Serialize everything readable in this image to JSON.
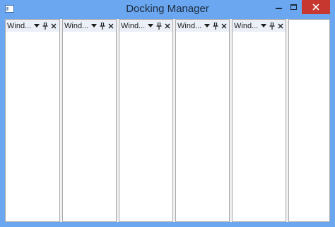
{
  "window": {
    "title": "Docking Manager",
    "frame_color": "#6aa7f0",
    "close_color": "#c7372f"
  },
  "panes": [
    {
      "title": "Wind...",
      "buttons": [
        "dropdown-icon",
        "pin-icon",
        "close-icon"
      ]
    },
    {
      "title": "Wind...",
      "buttons": [
        "dropdown-icon",
        "pin-icon",
        "close-icon"
      ]
    },
    {
      "title": "Wind...",
      "buttons": [
        "dropdown-icon",
        "pin-icon",
        "close-icon"
      ]
    },
    {
      "title": "Wind...",
      "buttons": [
        "dropdown-icon",
        "pin-icon",
        "close-icon"
      ]
    },
    {
      "title": "Wind...",
      "buttons": [
        "dropdown-icon",
        "pin-icon",
        "close-icon"
      ]
    }
  ]
}
